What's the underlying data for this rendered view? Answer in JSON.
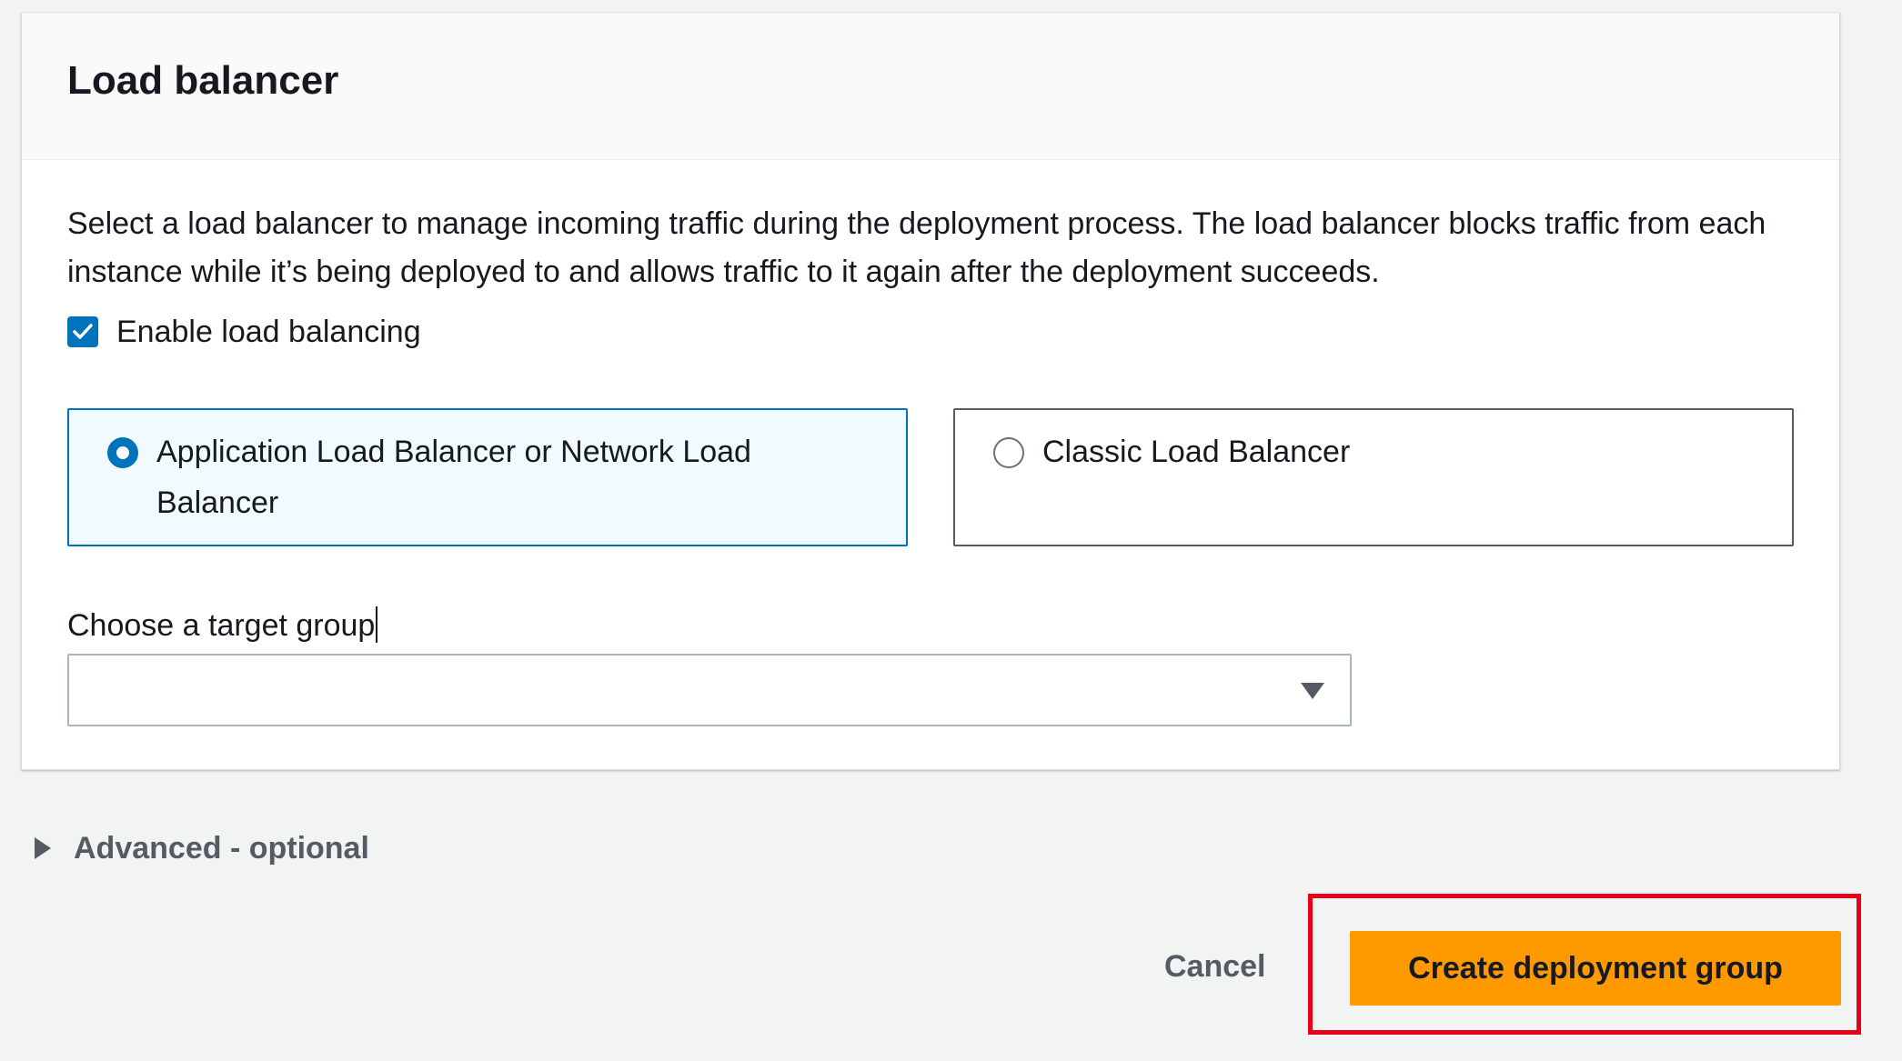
{
  "panel": {
    "title": "Load balancer",
    "description": "Select a load balancer to manage incoming traffic during the deployment process. The load balancer blocks traffic from each instance while it’s being deployed to and allows traffic to it again after the deployment succeeds.",
    "enable_checkbox": {
      "label": "Enable load balancing",
      "checked": true
    },
    "options": [
      {
        "label": "Application Load Balancer or Network Load Balancer",
        "selected": true
      },
      {
        "label": "Classic Load Balancer",
        "selected": false
      }
    ],
    "target_group": {
      "label": "Choose a target group",
      "value": ""
    }
  },
  "advanced": {
    "label": "Advanced - optional"
  },
  "actions": {
    "cancel_label": "Cancel",
    "create_label": "Create deployment group"
  },
  "colors": {
    "accent": "#0073bb",
    "primary_button": "#ff9900",
    "highlight": "#e8001a",
    "background": "#f2f3f3"
  }
}
